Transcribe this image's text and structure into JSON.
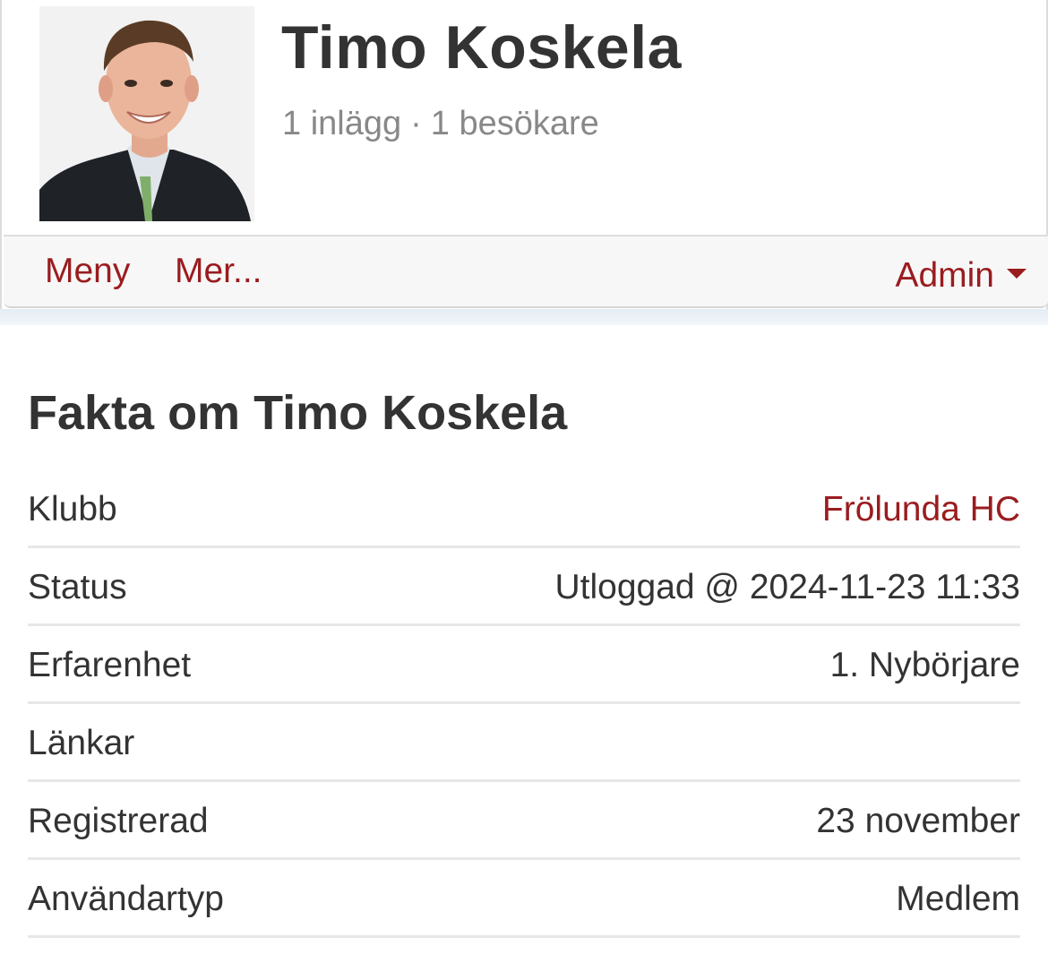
{
  "profile": {
    "name": "Timo Koskela",
    "posts": "1 inlägg",
    "separator": "·",
    "visitors": "1 besökare",
    "avatar_icon": "profile-photo"
  },
  "nav": {
    "menu_label": "Meny",
    "more_label": "Mer...",
    "admin_label": "Admin"
  },
  "facts": {
    "title": "Fakta om Timo Koskela",
    "rows": [
      {
        "label": "Klubb",
        "value": "Frölunda HC"
      },
      {
        "label": "Status",
        "value": "Utloggad @ 2024-11-23 11:33"
      },
      {
        "label": "Erfarenhet",
        "value": "1. Nybörjare"
      },
      {
        "label": "Länkar",
        "value": ""
      },
      {
        "label": "Registrerad",
        "value": "23 november"
      },
      {
        "label": "Användartyp",
        "value": "Medlem"
      }
    ]
  },
  "colors": {
    "accent": "#9a1c1f",
    "text": "#333333",
    "muted": "#888888"
  }
}
